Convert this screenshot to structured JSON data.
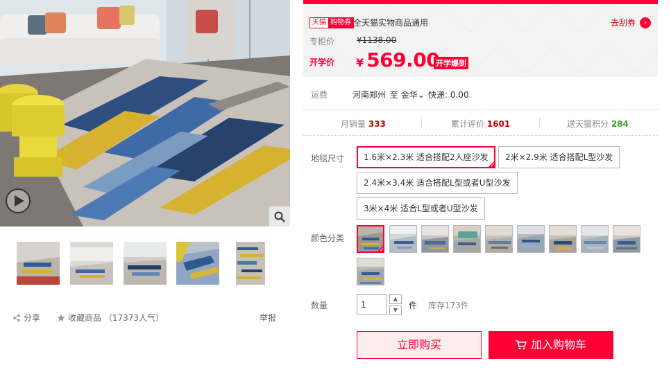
{
  "promo": {
    "tag_tmall": "天猫",
    "tag_coupon": "购物券",
    "coupon_desc": "全天猫实物商品通用",
    "get_coupon": "去刮券",
    "orig_label": "专柜价",
    "orig_price": "¥1138.00",
    "sale_label": "开学价",
    "sale_currency": "¥",
    "sale_price": "569.00",
    "sale_badge": "开学爆到"
  },
  "shipping": {
    "label": "运费",
    "from": "河南郑州",
    "to": "至 金华",
    "fee": "快递: 0.00"
  },
  "stats": {
    "monthly_label": "月销量",
    "monthly_value": "333",
    "reviews_label": "累计评价",
    "reviews_value": "1601",
    "points_label": "送天猫积分",
    "points_value": "284"
  },
  "sizes": {
    "label": "地毯尺寸",
    "options": [
      "1.6米×2.3米 适合搭配2人座沙发",
      "2米×2.9米 适合搭配L型沙发",
      "2.4米×3.4米 适合搭配L型或者U型沙发",
      "3米×4米 适合L型或者U型沙发"
    ],
    "selected_index": 0
  },
  "colors": {
    "label": "颜色分类",
    "count": 10,
    "selected_index": 0
  },
  "quantity": {
    "label": "数量",
    "value": "1",
    "unit": "件",
    "stock": "库存173件"
  },
  "actions": {
    "buy_now": "立即购买",
    "add_to_cart": "加入购物车"
  },
  "gallery": {
    "share": "分享",
    "favorite": "收藏商品 （17373人气）",
    "report": "举报"
  },
  "colors_palette": {
    "accent": "#ff0036",
    "price_red": "#c40000",
    "points_green": "#3ba52f"
  }
}
